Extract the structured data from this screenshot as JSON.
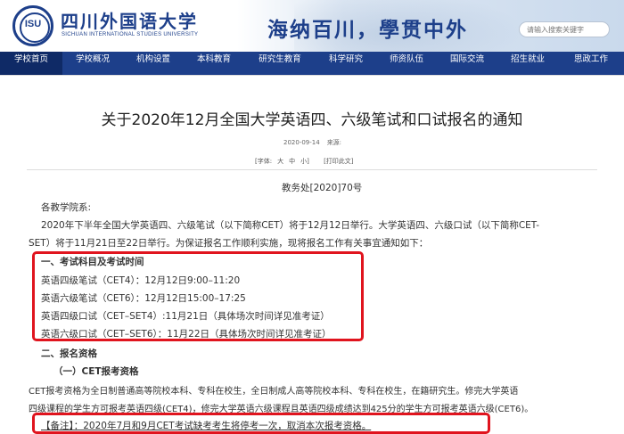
{
  "header": {
    "logo_text": "ISU",
    "university_name": "四川外国语大学",
    "university_name_en": "SICHUAN INTERNATIONAL STUDIES UNIVERSITY",
    "slogan": "海纳百川，學贯中外",
    "search_placeholder": "请输入搜索关键字"
  },
  "nav": {
    "items": [
      {
        "label": "学校首页",
        "active": true
      },
      {
        "label": "学校概况"
      },
      {
        "label": "机构设置"
      },
      {
        "label": "本科教育"
      },
      {
        "label": "研究生教育"
      },
      {
        "label": "科学研究"
      },
      {
        "label": "师资队伍"
      },
      {
        "label": "国际交流"
      },
      {
        "label": "招生就业"
      },
      {
        "label": "思政工作"
      }
    ]
  },
  "article": {
    "title": "关于2020年12月全国大学英语四、六级笔试和口试报名的通知",
    "date": "2020-09-14",
    "source_label": "来源:",
    "font_size_label": "[字体:",
    "font_large": "大",
    "font_medium": "中",
    "font_small": "小]",
    "print_label": "[打印此文]",
    "doc_number": "教务处[2020]70号",
    "salutation": "各教学院系:",
    "intro_line1": "2020年下半年全国大学英语四、六级笔试（以下简称CET）将于12月12日举行。大学英语四、六级口试（以下简称CET-",
    "intro_line2": "SET）将于11月21日至22日举行。为保证报名工作顺利实施，现将报名工作有关事宜通知如下：",
    "section1_heading": "一、考试科目及考试时间",
    "section1_items": [
      "英语四级笔试（CET4）：12月12日9:00–11:20",
      "英语六级笔试（CET6）：12月12日15:00–17:25",
      "英语四级口试（CET–SET4）:11月21日（具体场次时间详见准考证）",
      "英语六级口试（CET–SET6）：11月22日（具体场次时间详见准考证）"
    ],
    "section2_heading": "二、报名资格",
    "section2_sub": "（一）CET报考资格",
    "section2_line1": "CET报考资格为全日制普通高等院校本科、专科在校生，全日制成人高等院校本科、专科在校生，在籍研究生。修完大学英语",
    "section2_line2": "四级课程的学生方可报考英语四级(CET4)，修完大学英语六级课程且英语四级成绩达到425分的学生方可报考英语六级(CET6)。",
    "note": "【备注】：2020年7月和9月CET考试缺考考生将停考一次，取消本次报考资格。"
  },
  "colors": {
    "brand_blue": "#1d3f8a",
    "highlight_red": "#e0141e"
  }
}
